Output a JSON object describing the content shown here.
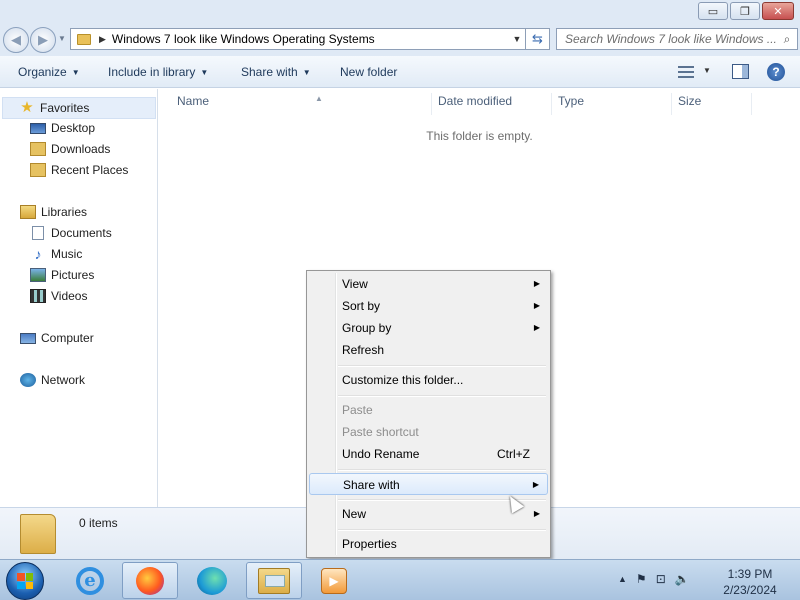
{
  "window": {
    "minimize_glyph": "▭",
    "maximize_glyph": "❐",
    "close_glyph": "✕"
  },
  "address_bar": {
    "path": "Windows 7 look like Windows Operating Systems",
    "search_placeholder": "Search Windows 7 look like Windows ..."
  },
  "commands": {
    "organize": "Organize",
    "include_in_library": "Include in library",
    "share_with": "Share with",
    "new_folder": "New folder"
  },
  "sidebar": {
    "favorites": "Favorites",
    "desktop": "Desktop",
    "downloads": "Downloads",
    "recent_places": "Recent Places",
    "libraries": "Libraries",
    "documents": "Documents",
    "music": "Music",
    "pictures": "Pictures",
    "videos": "Videos",
    "computer": "Computer",
    "network": "Network"
  },
  "columns": {
    "name": "Name",
    "date_modified": "Date modified",
    "type": "Type",
    "size": "Size"
  },
  "file_list": {
    "empty_message": "This folder is empty."
  },
  "details": {
    "items_count": "0 items"
  },
  "context_menu": {
    "view": "View",
    "sort_by": "Sort by",
    "group_by": "Group by",
    "refresh": "Refresh",
    "customize": "Customize this folder...",
    "paste": "Paste",
    "paste_shortcut": "Paste shortcut",
    "undo_rename": "Undo Rename",
    "undo_shortcut": "Ctrl+Z",
    "share_with": "Share with",
    "new": "New",
    "properties": "Properties"
  },
  "taskbar": {
    "time": "1:39 PM",
    "date": "2/23/2024"
  }
}
